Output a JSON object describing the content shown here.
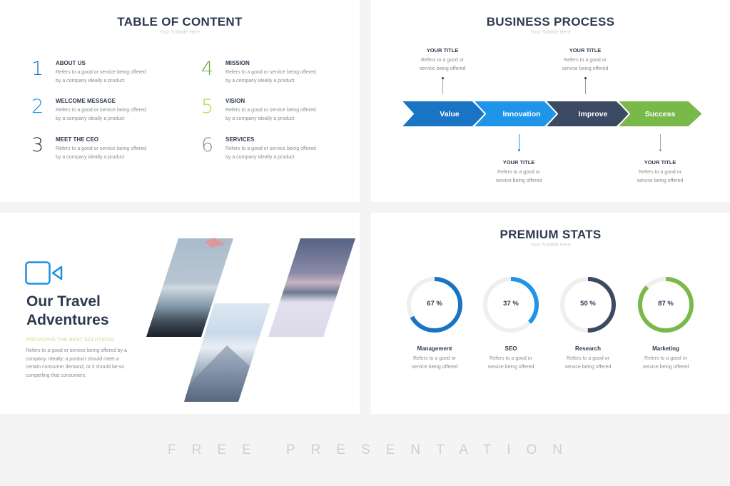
{
  "toc": {
    "title": "TABLE OF CONTENT",
    "subtitle": "Your Subtitle Here",
    "items": [
      {
        "number": "1",
        "title": "ABOUT US",
        "desc_line1": "Refers to a good or service being offered",
        "desc_line2": "by a company ideally a product",
        "color": "#1a6fb5"
      },
      {
        "number": "2",
        "title": "WELCOME MESSAGE",
        "desc_line1": "Refers to a good or service being offered",
        "desc_line2": "by a company ideally a product",
        "color": "#1e8fe0"
      },
      {
        "number": "3",
        "title": "MEET THE CEO",
        "desc_line1": "Refers to a good or service being offered",
        "desc_line2": "by a company ideally a product",
        "color": "#2e3a4f"
      },
      {
        "number": "4",
        "title": "MISSION",
        "desc_line1": "Refers to a good or service being offered",
        "desc_line2": "by a company ideally a product",
        "color": "#6aad3c"
      },
      {
        "number": "5",
        "title": "VISION",
        "desc_line1": "Refers to a good or service being offered",
        "desc_line2": "by a company ideally a product",
        "color": "#a7dc4a"
      },
      {
        "number": "6",
        "title": "SERVICES",
        "desc_line1": "Refers to a good or service being offered",
        "desc_line2": "by a company ideally a product",
        "color": "#8e8e8e"
      }
    ]
  },
  "process": {
    "title": "BUSINESS PROCESS",
    "subtitle": "Your Subtitle Here",
    "steps": [
      {
        "label": "Value",
        "color": "#1a74c4"
      },
      {
        "label": "Innovation",
        "color": "#1f95ea"
      },
      {
        "label": "Improve",
        "color": "#3b4a62"
      },
      {
        "label": "Success",
        "color": "#79b94a"
      }
    ],
    "notes": [
      {
        "title": "YOUR TITLE",
        "line1": "Refers to a good or",
        "line2": "service being offered",
        "step": "Value"
      },
      {
        "title": "YOUR TITLE",
        "line1": "Refers to a good or",
        "line2": "service being offered",
        "step": "Innovation"
      },
      {
        "title": "YOUR TITLE",
        "line1": "Refers to a good or",
        "line2": "service being offered",
        "step": "Improve"
      },
      {
        "title": "YOUR TITLE",
        "line1": "Refers to a good or",
        "line2": "service being offered",
        "step": "Success"
      }
    ]
  },
  "travel": {
    "icon": "video-camera-icon",
    "icon_color": "#1e8fe0",
    "heading_line1": "Our Travel",
    "heading_line2": "Adventures",
    "tagline": "PROVIDING THE BEST SOLUTIONS",
    "desc_lines": [
      "Refers to a good or service being offered by a",
      "company. Ideally, a product should meet a",
      "certain consumer demand, or it should be so",
      "compelling that consumers."
    ],
    "photos": [
      "mountain-peak-sunset-photo",
      "snowy-mountain-clouds-photo",
      "winter-field-dusk-photo"
    ]
  },
  "stats": {
    "title": "PREMIUM STATS",
    "subtitle": "Your Subtitle Here",
    "track_color": "#efefef",
    "items": [
      {
        "name": "Management",
        "percent": 67,
        "label": "67 %",
        "color": "#1a74c4",
        "line1": "Refers to a good or",
        "line2": "service being offered"
      },
      {
        "name": "SEO",
        "percent": 37,
        "label": "37 %",
        "color": "#1f95ea",
        "line1": "Refers to a good or",
        "line2": "service being offered"
      },
      {
        "name": "Research",
        "percent": 50,
        "label": "50 %",
        "color": "#3b4a62",
        "line1": "Refers to a good or",
        "line2": "service being offered"
      },
      {
        "name": "Marketing",
        "percent": 87,
        "label": "87 %",
        "color": "#79b94a",
        "line1": "Refers to a good or",
        "line2": "service being offered"
      }
    ]
  },
  "footer": {
    "text": "FREE PRESENTATION"
  }
}
